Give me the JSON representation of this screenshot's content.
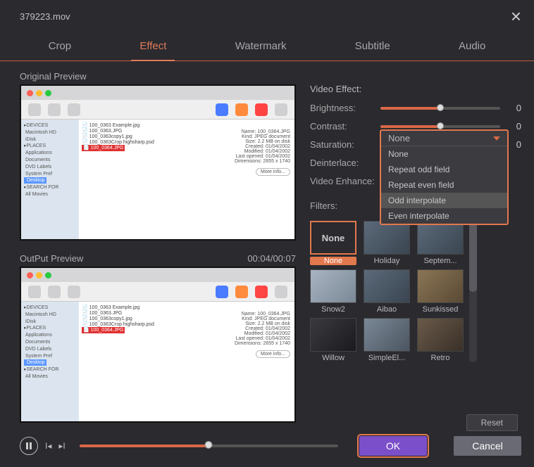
{
  "window": {
    "title": "379223.mov"
  },
  "tabs": {
    "items": [
      "Crop",
      "Effect",
      "Watermark",
      "Subtitle",
      "Audio"
    ],
    "active": 1
  },
  "previews": {
    "original_label": "Original Preview",
    "output_label": "OutPut Preview",
    "timecode": "00:04/00:07"
  },
  "effects": {
    "section_title": "Video Effect:",
    "brightness": {
      "label": "Brightness:",
      "value": "0",
      "percent": 50
    },
    "contrast": {
      "label": "Contrast:",
      "value": "0",
      "percent": 50
    },
    "saturation": {
      "label": "Saturation:",
      "value": "0",
      "percent": 50
    },
    "deinterlace": {
      "label": "Deinterlace:",
      "current": "None",
      "options": [
        "None",
        "Repeat odd field",
        "Repeat even field",
        "Odd interpolate",
        "Even interpolate"
      ],
      "highlighted": "Odd interpolate"
    },
    "enhance": {
      "label": "Video Enhance:"
    }
  },
  "filters": {
    "label": "Filters:",
    "items": [
      {
        "name": "None",
        "selected": true
      },
      {
        "name": "Holiday"
      },
      {
        "name": "Septem..."
      },
      {
        "name": "Snow2"
      },
      {
        "name": "Aibao"
      },
      {
        "name": "Sunkissed"
      },
      {
        "name": "Willow"
      },
      {
        "name": "SimpleEl..."
      },
      {
        "name": "Retro"
      }
    ],
    "none_thumb_text": "None"
  },
  "buttons": {
    "reset": "Reset",
    "ok": "OK",
    "cancel": "Cancel"
  }
}
